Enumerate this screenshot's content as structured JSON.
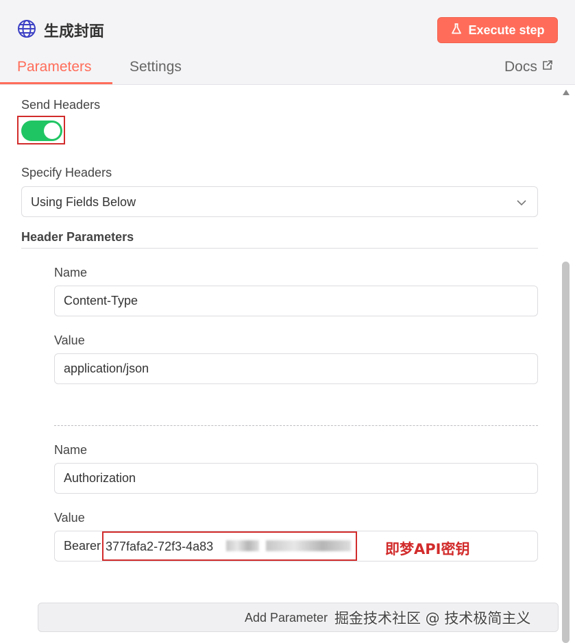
{
  "header": {
    "title": "生成封面",
    "execute_label": "Execute step",
    "tabs": [
      {
        "label": "Parameters",
        "active": true
      },
      {
        "label": "Settings",
        "active": false
      }
    ],
    "docs_label": "Docs"
  },
  "send_headers": {
    "label": "Send Headers",
    "enabled": true
  },
  "specify_headers": {
    "label": "Specify Headers",
    "value": "Using Fields Below"
  },
  "header_parameters": {
    "title": "Header Parameters",
    "items": [
      {
        "name_label": "Name",
        "name": "Content-Type",
        "value_label": "Value",
        "value": "application/json"
      },
      {
        "name_label": "Name",
        "name": "Authorization",
        "value_label": "Value",
        "value_prefix": "Bearer",
        "value_visible": "377fafa2-72f3-4a83"
      }
    ]
  },
  "annotation": "即梦API密钥",
  "add_parameter_label": "Add Parameter",
  "watermark": "掘金技术社区 @ 技术极简主义",
  "colors": {
    "accent": "#ff6d5a",
    "toggle_on": "#20c563",
    "highlight": "#d22b2b"
  }
}
